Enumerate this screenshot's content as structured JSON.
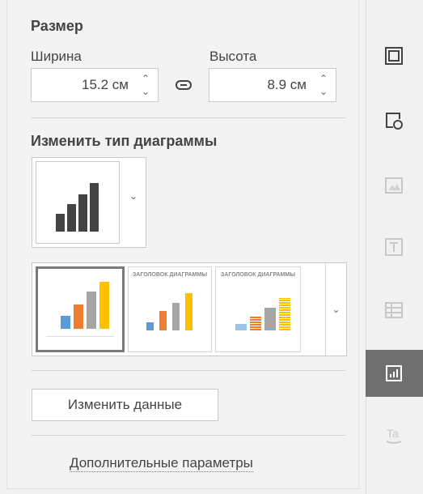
{
  "size": {
    "heading": "Размер",
    "width_label": "Ширина",
    "height_label": "Высота",
    "width_value": "15.2 см",
    "height_value": "8.9 см"
  },
  "chart_type": {
    "heading": "Изменить тип диаграммы"
  },
  "styles": {
    "thumb2_title": "ЗАГОЛОВОК ДИАГРАММЫ",
    "thumb3_title": "ЗАГОЛОВОК ДИАГРАММЫ"
  },
  "buttons": {
    "edit_data": "Изменить данные",
    "more_settings": "Дополнительные параметры"
  },
  "colors": {
    "accent_active": "#6f6f6f",
    "bar_blue": "#5b9bd5",
    "bar_orange": "#ed7d31",
    "bar_gray": "#a5a5a5",
    "bar_yellow": "#ffc000"
  },
  "right_bar": {
    "icons": [
      "paragraph-settings-icon",
      "shape-settings-icon",
      "image-settings-icon",
      "text-art-settings-icon",
      "table-settings-icon",
      "chart-settings-icon",
      "signature-settings-icon"
    ],
    "active": "chart-settings-icon"
  }
}
